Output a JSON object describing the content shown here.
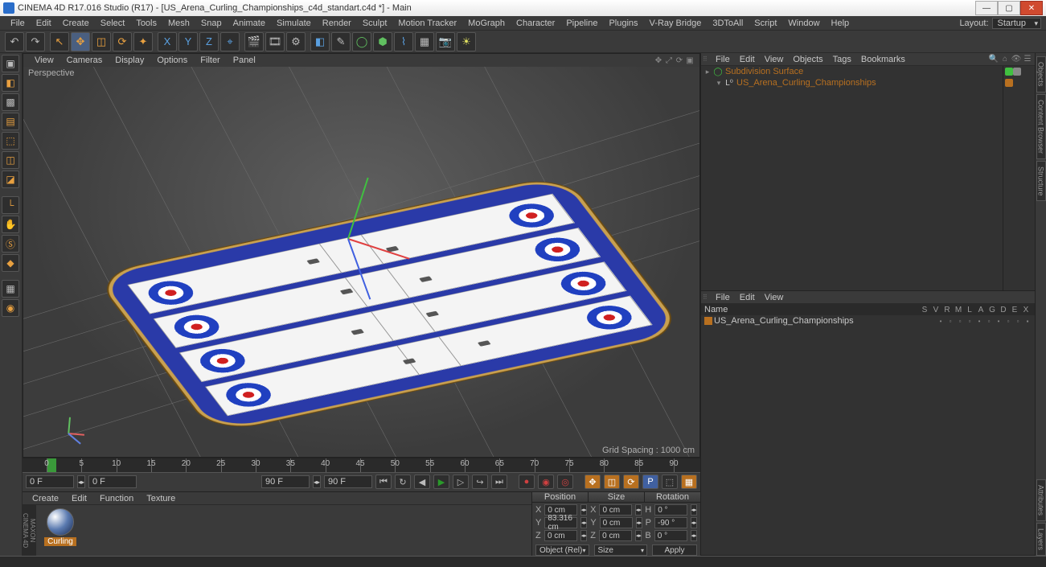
{
  "titlebar": {
    "text": "CINEMA 4D R17.016 Studio (R17) - [US_Arena_Curling_Championships_c4d_standart.c4d *] - Main"
  },
  "menubar": {
    "items": [
      "File",
      "Edit",
      "Create",
      "Select",
      "Tools",
      "Mesh",
      "Snap",
      "Animate",
      "Simulate",
      "Render",
      "Sculpt",
      "Motion Tracker",
      "MoGraph",
      "Character",
      "Pipeline",
      "Plugins",
      "V-Ray Bridge",
      "3DToAll",
      "Script",
      "Window",
      "Help"
    ],
    "layout_label": "Layout:",
    "layout_value": "Startup"
  },
  "viewport": {
    "menu": [
      "View",
      "Cameras",
      "Display",
      "Options",
      "Filter",
      "Panel"
    ],
    "label": "Perspective",
    "grid_spacing": "Grid Spacing : 1000 cm"
  },
  "timeline": {
    "ticks": [
      0,
      5,
      10,
      15,
      20,
      25,
      30,
      35,
      40,
      45,
      50,
      55,
      60,
      65,
      70,
      75,
      80,
      85,
      90
    ],
    "start_frame": "0 F",
    "start_frame2": "0 F",
    "end_frame": "90 F",
    "end_frame2": "90 F"
  },
  "materials": {
    "menu": [
      "Create",
      "Edit",
      "Function",
      "Texture"
    ],
    "logo": "MAXON CINEMA 4D",
    "items": [
      {
        "label": "Curling"
      }
    ]
  },
  "coords": {
    "headers": [
      "Position",
      "Size",
      "Rotation"
    ],
    "rows": [
      {
        "axis": "X",
        "pos": "0 cm",
        "size_axis": "X",
        "size": "0 cm",
        "rot_axis": "H",
        "rot": "0 °"
      },
      {
        "axis": "Y",
        "pos": "83.316 cm",
        "size_axis": "Y",
        "size": "0 cm",
        "rot_axis": "P",
        "rot": "-90 °"
      },
      {
        "axis": "Z",
        "pos": "0 cm",
        "size_axis": "Z",
        "size": "0 cm",
        "rot_axis": "B",
        "rot": "0 °"
      }
    ],
    "mode1": "Object (Rel)",
    "mode2": "Size",
    "apply": "Apply"
  },
  "objects_panel": {
    "menu": [
      "File",
      "Edit",
      "View",
      "Objects",
      "Tags",
      "Bookmarks"
    ],
    "tree": [
      {
        "indent": 0,
        "exp": "▸",
        "icon": "◯",
        "icon_color": "#40c040",
        "name": "Subdivision Surface",
        "name_color": "#b87020",
        "tag1": "#40c040",
        "tag2": "#888"
      },
      {
        "indent": 1,
        "exp": "▾",
        "icon": "L⁰",
        "icon_color": "#ccc",
        "name": "US_Arena_Curling_Championships",
        "name_color": "#b87020",
        "tag1": "#b87020",
        "tag2": ""
      }
    ]
  },
  "takes_panel": {
    "menu": [
      "File",
      "Edit",
      "View"
    ],
    "header_name": "Name",
    "header_cols": [
      "S",
      "V",
      "R",
      "M",
      "L",
      "A",
      "G",
      "D",
      "E",
      "X"
    ],
    "row": {
      "name": "US_Arena_Curling_Championships"
    }
  },
  "right_tabs": [
    "Objects",
    "Content Browser",
    "Structure"
  ],
  "right_tabs2": [
    "Attributes",
    "Layers"
  ]
}
